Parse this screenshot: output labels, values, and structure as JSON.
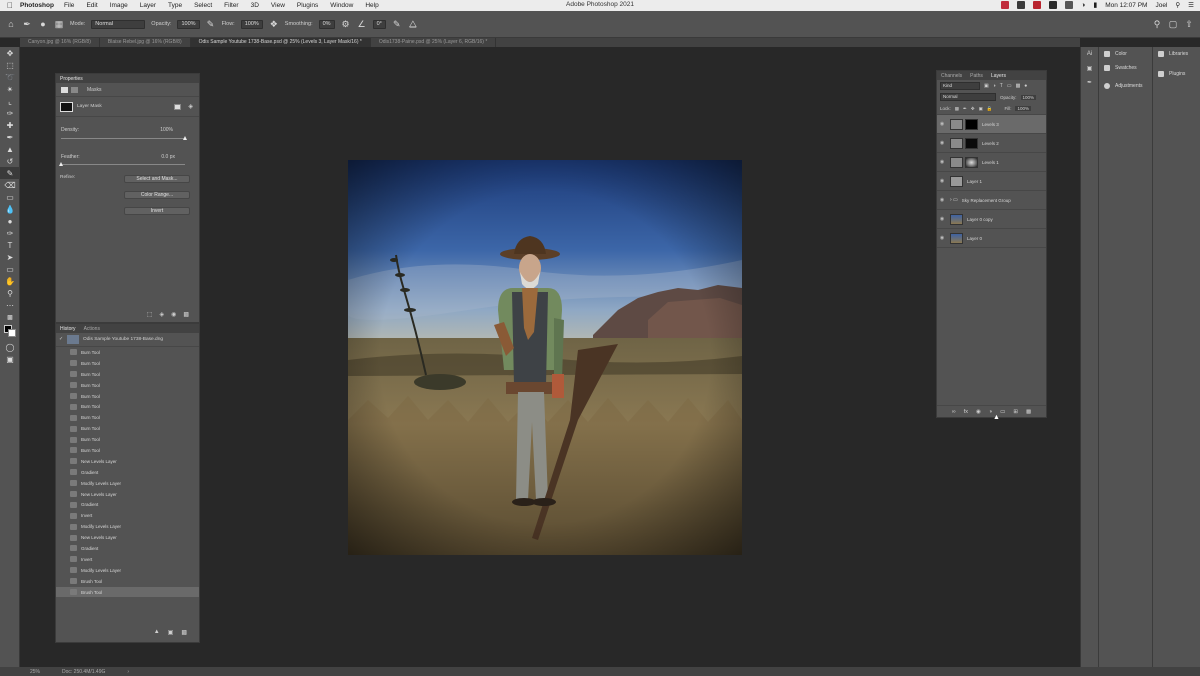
{
  "menubar": {
    "app": "Photoshop",
    "items": [
      "File",
      "Edit",
      "Image",
      "Layer",
      "Type",
      "Select",
      "Filter",
      "3D",
      "View",
      "Plugins",
      "Window",
      "Help"
    ],
    "window_title": "Adobe Photoshop 2021",
    "clock": "Mon 12:07 PM",
    "user": "Joel"
  },
  "options": {
    "mode_label": "Mode:",
    "mode_value": "Normal",
    "opacity_label": "Opacity:",
    "opacity_value": "100%",
    "flow_label": "Flow:",
    "flow_value": "100%",
    "smoothing_label": "Smoothing:",
    "smoothing_value": "0%",
    "angle_value": "0°"
  },
  "tabs": [
    "Canyon.jpg @ 16% (RGB/8)",
    "Blaise Rebel.jpg @ 16% (RGB/8)",
    "Odis Sample Youtube 1738-Base.psd @ 25% (Levels 3, Layer Mask/16) *",
    "Odis1738-Paine.psd @ 25% (Layer 6, RGB/16) *"
  ],
  "properties": {
    "title": "Properties",
    "section": "Masks",
    "mask_type": "Layer Mask",
    "density_label": "Density:",
    "density_value": "100%",
    "density_level": 1.0,
    "feather_label": "Feather:",
    "feather_value": "0.0 px",
    "feather_level": 0.0,
    "refine_label": "Refine:",
    "buttons": [
      "Select and Mask...",
      "Color Range...",
      "Invert"
    ]
  },
  "history": {
    "tabs": [
      "History",
      "Actions"
    ],
    "snapshot": "Odis Sample Youtube 1738-Base.dng",
    "items": [
      {
        "label": "Burn Tool"
      },
      {
        "label": "Burn Tool"
      },
      {
        "label": "Burn Tool"
      },
      {
        "label": "Burn Tool"
      },
      {
        "label": "Burn Tool"
      },
      {
        "label": "Burn Tool"
      },
      {
        "label": "Burn Tool"
      },
      {
        "label": "Burn Tool"
      },
      {
        "label": "Burn Tool"
      },
      {
        "label": "Burn Tool"
      },
      {
        "label": "New Levels Layer"
      },
      {
        "label": "Gradient"
      },
      {
        "label": "Modify Levels Layer"
      },
      {
        "label": "New Levels Layer"
      },
      {
        "label": "Gradient"
      },
      {
        "label": "Invert"
      },
      {
        "label": "Modify Levels Layer"
      },
      {
        "label": "New Levels Layer"
      },
      {
        "label": "Gradient"
      },
      {
        "label": "Invert"
      },
      {
        "label": "Modify Levels Layer"
      },
      {
        "label": "Brush Tool"
      },
      {
        "label": "Brush Tool"
      }
    ]
  },
  "layers": {
    "tabs": [
      "Channels",
      "Paths",
      "Layers"
    ],
    "kind_label": "Kind",
    "blend_mode": "Normal",
    "opacity_label": "Opacity:",
    "opacity_value": "100%",
    "lock_label": "Lock:",
    "fill_label": "Fill:",
    "fill_value": "100%",
    "items": [
      {
        "name": "Levels 3"
      },
      {
        "name": "Levels 2"
      },
      {
        "name": "Levels 1"
      },
      {
        "name": "Layer 1"
      },
      {
        "name": "Sky Replacement Group"
      },
      {
        "name": "Layer 0 copy"
      },
      {
        "name": "Layer 0"
      }
    ]
  },
  "dock": {
    "items": [
      "Color",
      "Swatches",
      "Adjustments"
    ],
    "items2": [
      "Libraries",
      "Plugins"
    ]
  },
  "status": {
    "zoom": "25%",
    "doc": "Doc: 250.4M/1.49G"
  }
}
